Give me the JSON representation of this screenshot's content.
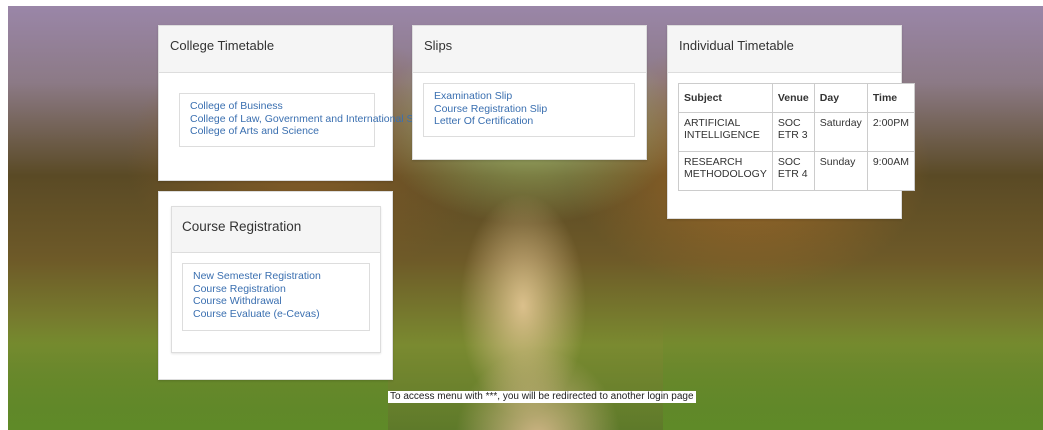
{
  "college_timetable": {
    "title": "College Timetable",
    "links": [
      "College of Business",
      "College of Law, Government and International Studies",
      "College of Arts and Science"
    ]
  },
  "slips": {
    "title": "Slips",
    "links": [
      "Examination Slip",
      "Course Registration Slip",
      "Letter Of Certification"
    ]
  },
  "individual_timetable": {
    "title": "Individual Timetable",
    "headers": [
      "Subject",
      "Venue",
      "Day",
      "Time"
    ],
    "rows": [
      [
        "ARTIFICIAL INTELLIGENCE",
        "SOC ETR 3",
        "Saturday",
        "2:00PM"
      ],
      [
        "RESEARCH METHODOLOGY",
        "SOC ETR 4",
        "Sunday",
        "9:00AM"
      ]
    ]
  },
  "course_registration": {
    "title": "Course Registration",
    "links": [
      "New Semester Registration",
      "Course Registration",
      "Course Withdrawal",
      "Course Evaluate (e-Cevas)"
    ]
  },
  "notice": "To access menu with ***, you will be redirected to another login page"
}
